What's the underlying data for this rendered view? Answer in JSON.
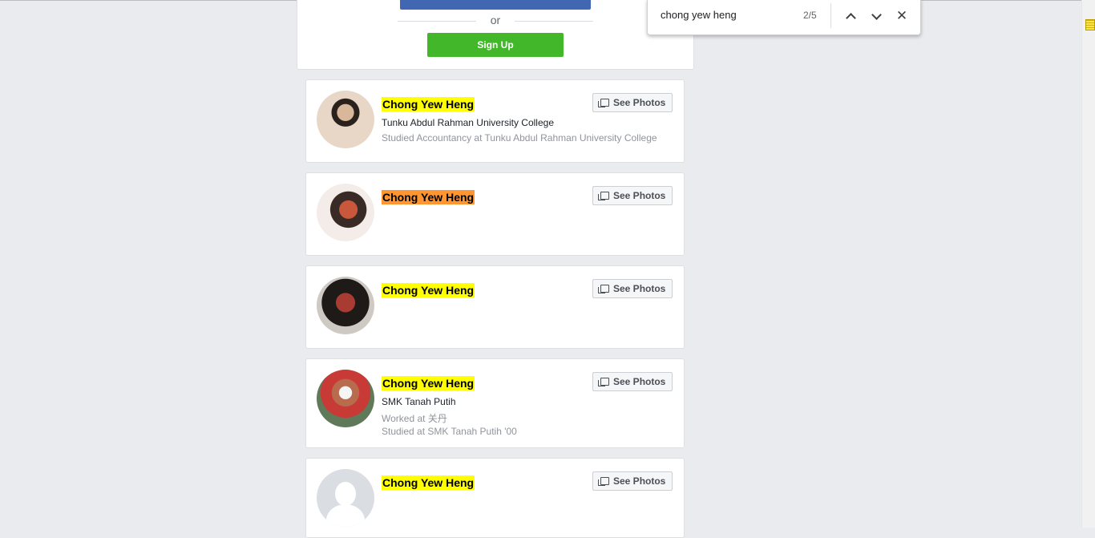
{
  "signup": {
    "or_text": "or",
    "signup_label": "Sign Up"
  },
  "find_bar": {
    "query": "chong yew heng",
    "count": "2/5"
  },
  "results": [
    {
      "name": "Chong Yew Heng",
      "line1": "Tunku Abdul Rahman University College",
      "line2": "Studied Accountancy at Tunku Abdul Rahman University College",
      "line3": "",
      "button": "See Photos",
      "active": false
    },
    {
      "name": "Chong Yew Heng",
      "line1": "",
      "line2": "",
      "line3": "",
      "button": "See Photos",
      "active": true
    },
    {
      "name": "Chong Yew Heng",
      "line1": "",
      "line2": "",
      "line3": "",
      "button": "See Photos",
      "active": false
    },
    {
      "name": "Chong Yew Heng",
      "line1": "SMK Tanah Putih",
      "line2": "Worked at 关丹",
      "line3": "Studied at SMK Tanah Putih '00",
      "button": "See Photos",
      "active": false
    },
    {
      "name": "Chong Yew Heng",
      "line1": "",
      "line2": "",
      "line3": "",
      "button": "See Photos",
      "active": false
    }
  ],
  "colors": {
    "highlight": "#ffff00",
    "active_highlight": "#ff9632",
    "signup_green": "#42b72a",
    "facebook_blue": "#4267b2"
  }
}
